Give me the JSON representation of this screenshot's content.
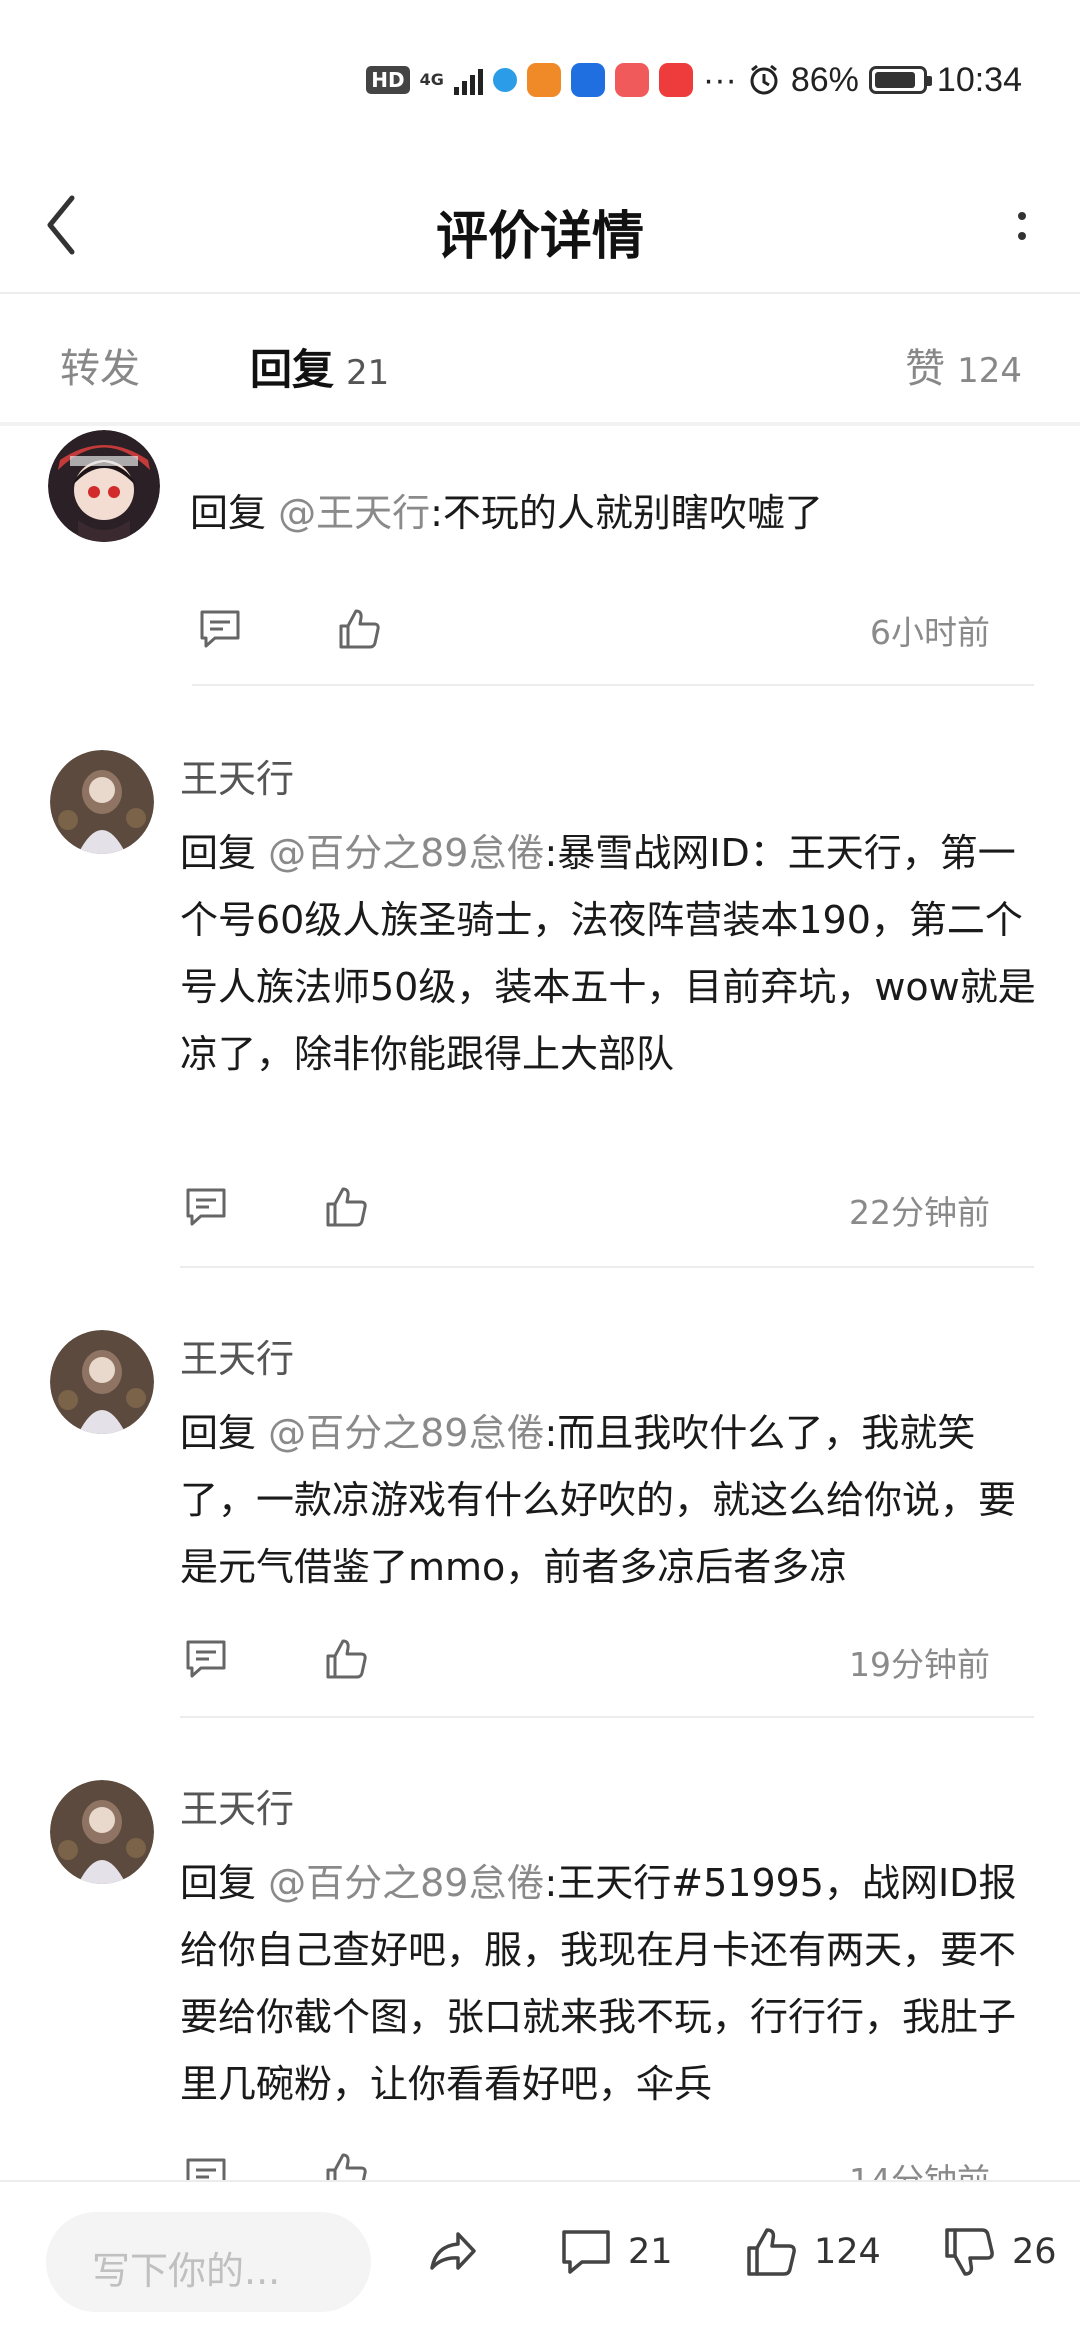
{
  "status_bar": {
    "hd_badge": "HD",
    "network": "4G",
    "more": "···",
    "battery_percent": "86%",
    "battery_level": 0.86,
    "time": "10:34"
  },
  "header": {
    "title": "评价详情"
  },
  "tabs": {
    "forward": "转发",
    "replies_label": "回复",
    "replies_count": "21",
    "likes_label": "赞",
    "likes_count": "124"
  },
  "comments": [
    {
      "username": "",
      "reply_prefix": "回复 ",
      "mention": "@王天行",
      "text": ":不玩的人就别瞎吹嘘了",
      "time": "6小时前"
    },
    {
      "username": "王天行",
      "reply_prefix": "回复 ",
      "mention": "@百分之89怠倦",
      "text": ":暴雪战网ID：王天行，第一个号60级人族圣骑士，法夜阵营装本190，第二个号人族法师50级，装本五十，目前弃坑，wow就是凉了，除非你能跟得上大部队",
      "time": "22分钟前"
    },
    {
      "username": "王天行",
      "reply_prefix": "回复 ",
      "mention": "@百分之89怠倦",
      "text": ":而且我吹什么了，我就笑了，一款凉游戏有什么好吹的，就这么给你说，要是元气借鉴了mmo，前者多凉后者多凉",
      "time": "19分钟前"
    },
    {
      "username": "王天行",
      "reply_prefix": "回复 ",
      "mention": "@百分之89怠倦",
      "text": ":王天行#51995，战网ID报给你自己查好吧，服，我现在月卡还有两天，要不要给你截个图，张口就来我不玩，行行行，我肚子里几碗粉，让你看看好吧，伞兵",
      "time": "14分钟前"
    }
  ],
  "bottom_bar": {
    "input_placeholder": "写下你的...",
    "comment_count": "21",
    "like_count": "124",
    "dislike_count": "26"
  }
}
